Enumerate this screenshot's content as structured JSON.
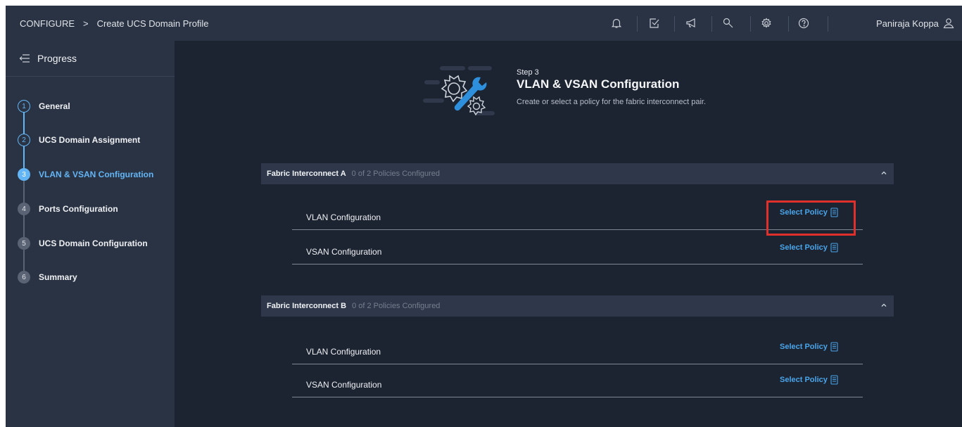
{
  "header": {
    "breadcrumb_root": "CONFIGURE",
    "breadcrumb_sep": ">",
    "breadcrumb_current": "Create UCS Domain Profile",
    "icons": [
      "bell-icon",
      "checklist-icon",
      "megaphone-icon",
      "search-icon",
      "gear-icon",
      "help-icon"
    ],
    "user_name": "Paniraja Koppa"
  },
  "sidebar": {
    "title": "Progress",
    "steps": [
      {
        "num": "1",
        "label": "General",
        "state": "done"
      },
      {
        "num": "2",
        "label": "UCS Domain Assignment",
        "state": "done"
      },
      {
        "num": "3",
        "label": "VLAN & VSAN Configuration",
        "state": "active"
      },
      {
        "num": "4",
        "label": "Ports Configuration",
        "state": "todo"
      },
      {
        "num": "5",
        "label": "UCS Domain Configuration",
        "state": "todo"
      },
      {
        "num": "6",
        "label": "Summary",
        "state": "todo"
      }
    ]
  },
  "main": {
    "step_label": "Step 3",
    "title": "VLAN & VSAN Configuration",
    "description": "Create or select a policy for the fabric interconnect pair.",
    "fabric_a": {
      "name": "Fabric Interconnect A",
      "status": "0 of 2 Policies Configured",
      "rows": [
        {
          "label": "VLAN Configuration",
          "action": "Select Policy"
        },
        {
          "label": "VSAN Configuration",
          "action": "Select Policy"
        }
      ]
    },
    "fabric_b": {
      "name": "Fabric Interconnect B",
      "status": "0 of 2 Policies Configured",
      "rows": [
        {
          "label": "VLAN Configuration",
          "action": "Select Policy"
        },
        {
          "label": "VSAN Configuration",
          "action": "Select Policy"
        }
      ]
    }
  },
  "colors": {
    "background": "#1c2331",
    "panel": "#2a3343",
    "accent": "#64b5f6",
    "link": "#49a5ea",
    "highlight_box": "#e0302b"
  }
}
